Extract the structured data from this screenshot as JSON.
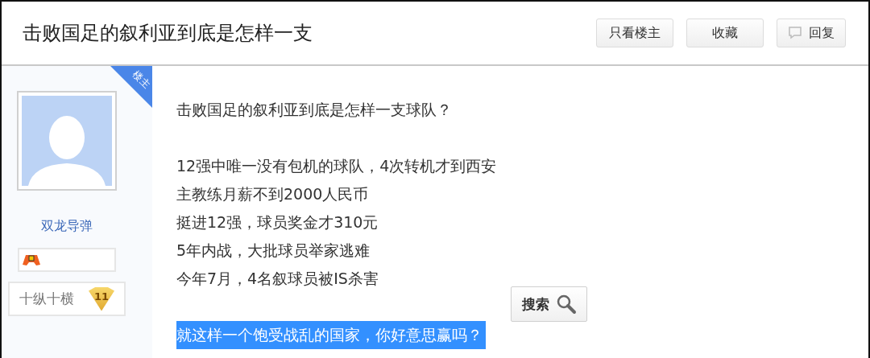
{
  "header": {
    "title": "击败国足的叙利亚到底是怎样一支",
    "buttons": [
      {
        "label": "只看楼主",
        "kind": "plain"
      },
      {
        "label": "收藏",
        "kind": "plain"
      },
      {
        "label": "回复",
        "kind": "reply"
      }
    ]
  },
  "author": {
    "badge": "楼主",
    "name": "双龙导弹",
    "level_title": "十纵十横",
    "level": "11"
  },
  "post": {
    "paragraphs": [
      {
        "lines": [
          {
            "text": "击败国足的叙利亚到底是怎样一支球队？",
            "selected": false
          }
        ]
      },
      {
        "lines": [
          {
            "text": "12强中唯一没有包机的球队，4次转机才到西安",
            "selected": false
          },
          {
            "text": "主教练月薪不到2000人民币",
            "selected": false
          },
          {
            "text": "挺进12强，球员奖金才310元",
            "selected": false
          },
          {
            "text": "5年内战，大批球员举家逃难",
            "selected": false
          },
          {
            "text": "今年7月，4名叙球员被IS杀害",
            "selected": false
          }
        ]
      },
      {
        "lines": [
          {
            "text": "就这样一个饱受战乱的国家，你好意思赢吗？",
            "selected": true
          }
        ]
      }
    ],
    "search_popup": {
      "label": "搜索"
    }
  }
}
